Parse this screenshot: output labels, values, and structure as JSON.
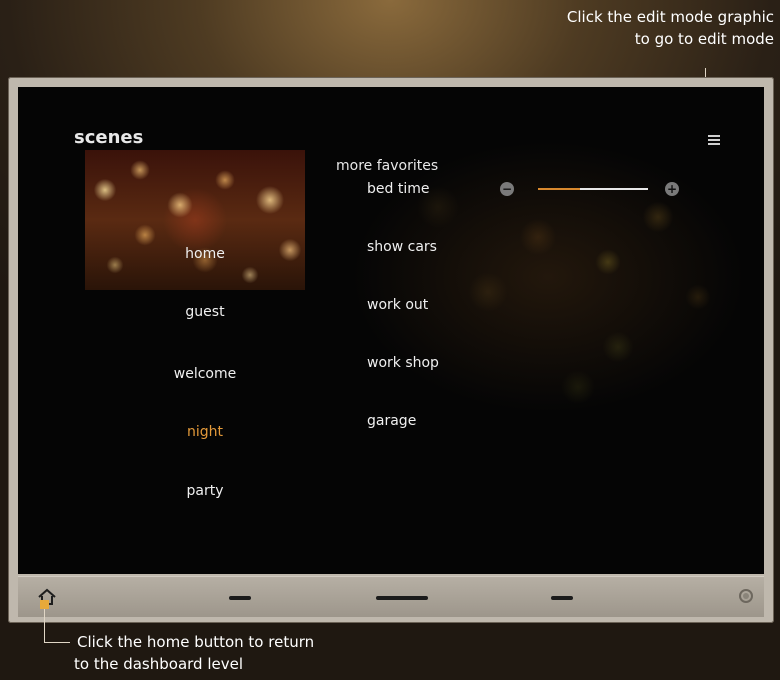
{
  "annotations": {
    "edit_mode_line1": "Click the edit mode graphic",
    "edit_mode_line2": "to go to edit mode",
    "home_line1": "Click the home button to return",
    "home_line2": "to the dashboard level"
  },
  "screen": {
    "title": "scenes",
    "scenes": [
      {
        "label": "home",
        "active": false
      },
      {
        "label": "guest",
        "active": false
      },
      {
        "label": "welcome",
        "active": false
      },
      {
        "label": "night",
        "active": true
      },
      {
        "label": "party",
        "active": false
      }
    ],
    "favorites": {
      "header": "more favorites",
      "items": [
        "bed time",
        "show cars",
        "work out",
        "work shop",
        "garage"
      ]
    },
    "dimmer": {
      "minus_symbol": "−",
      "plus_symbol": "+",
      "level": 0.38
    },
    "icons": {
      "edit_mode": "hamburger-menu-icon",
      "home": "home-icon",
      "power": "power-icon"
    }
  },
  "colors": {
    "accent": "#e49a3a",
    "dimmer_fill": "#d9892e",
    "callout_marker": "#e7a93a"
  }
}
